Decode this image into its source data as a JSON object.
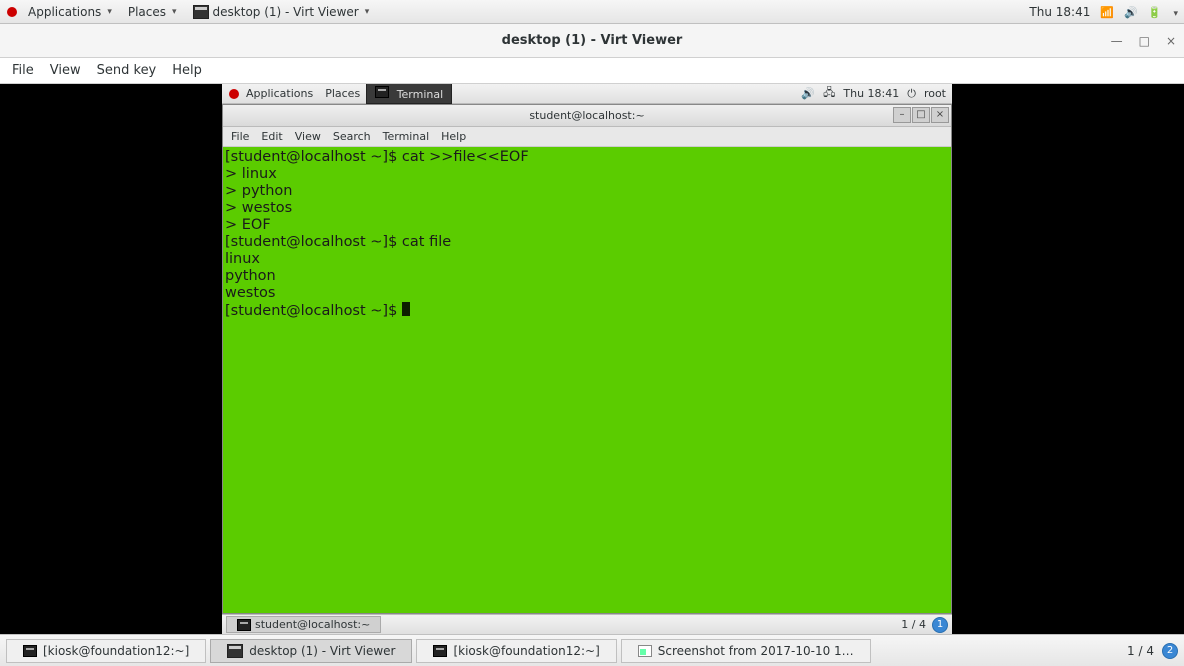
{
  "outer_topbar": {
    "applications": "Applications",
    "places": "Places",
    "active_task": "desktop (1) - Virt Viewer",
    "clock": "Thu 18:41"
  },
  "virt_window": {
    "title": "desktop (1) - Virt Viewer",
    "menus": [
      "File",
      "View",
      "Send key",
      "Help"
    ],
    "min": "—",
    "max": "□",
    "close": "×"
  },
  "inner_topbar": {
    "applications": "Applications",
    "places": "Places",
    "active_task": "Terminal",
    "clock": "Thu 18:41",
    "user": "root"
  },
  "terminal": {
    "title": "student@localhost:~",
    "menus": [
      "File",
      "Edit",
      "View",
      "Search",
      "Terminal",
      "Help"
    ],
    "content": "[student@localhost ~]$ cat >>file<<EOF\n> linux\n> python\n> westos\n> EOF\n[student@localhost ~]$ cat file\nlinux\npython\nwestos\n[student@localhost ~]$ "
  },
  "inner_bottombar": {
    "task": "student@localhost:~",
    "workspace": "1 / 4",
    "badge": "1"
  },
  "outer_bottombar": {
    "tasks": [
      "[kiosk@foundation12:~]",
      "desktop (1) - Virt Viewer",
      "[kiosk@foundation12:~]",
      "Screenshot from 2017-10-10 1…"
    ],
    "workspace": "1 / 4",
    "badge": "2"
  }
}
